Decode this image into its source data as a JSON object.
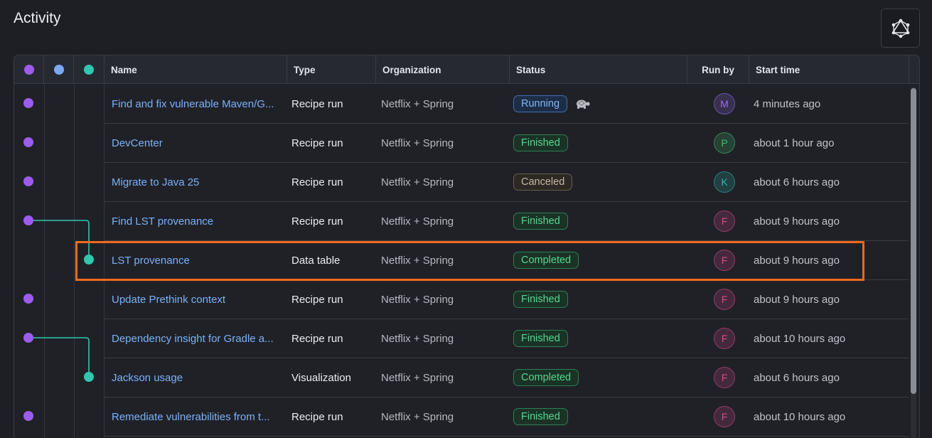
{
  "title": "Activity",
  "graph_button_icon": "graph-network-icon",
  "lanes": [
    {
      "color": "#9d5cf0"
    },
    {
      "color": "#7aa8f5"
    },
    {
      "color": "#2ec7b0"
    }
  ],
  "columns": {
    "name": "Name",
    "type": "Type",
    "organization": "Organization",
    "status": "Status",
    "run_by": "Run by",
    "start_time": "Start time"
  },
  "status_colors": {
    "running": "#82b5f8",
    "finished": "#57d690",
    "completed": "#57d690",
    "canceled": "#c6b9a8"
  },
  "rows": [
    {
      "name": "Find and fix vulnerable Maven/G...",
      "type": "Recipe run",
      "org": "Netflix + Spring",
      "status": "Running",
      "status_kind": "running",
      "slow_icon": "turtle-icon",
      "runby": "M",
      "avatar_color": "#9b6cf0",
      "start": "4 minutes ago",
      "lane": 0
    },
    {
      "name": "DevCenter",
      "type": "Recipe run",
      "org": "Netflix + Spring",
      "status": "Finished",
      "status_kind": "finished",
      "runby": "P",
      "avatar_color": "#3fc16e",
      "start": "about 1 hour ago",
      "lane": 0
    },
    {
      "name": "Migrate to Java 25",
      "type": "Recipe run",
      "org": "Netflix + Spring",
      "status": "Canceled",
      "status_kind": "canceled",
      "runby": "K",
      "avatar_color": "#2bb9b0",
      "start": "about 6 hours ago",
      "lane": 0
    },
    {
      "name": "Find LST provenance",
      "type": "Recipe run",
      "org": "Netflix + Spring",
      "status": "Finished",
      "status_kind": "finished",
      "runby": "F",
      "avatar_color": "#d94a8f",
      "start": "about 9 hours ago",
      "lane": 0
    },
    {
      "name": "LST provenance",
      "type": "Data table",
      "org": "Netflix + Spring",
      "status": "Completed",
      "status_kind": "completed",
      "runby": "F",
      "avatar_color": "#d94a8f",
      "start": "about 9 hours ago",
      "lane": 2
    },
    {
      "name": "Update Prethink context",
      "type": "Recipe run",
      "org": "Netflix + Spring",
      "status": "Finished",
      "status_kind": "finished",
      "runby": "F",
      "avatar_color": "#d94a8f",
      "start": "about 9 hours ago",
      "lane": 0
    },
    {
      "name": "Dependency insight for Gradle a...",
      "type": "Recipe run",
      "org": "Netflix + Spring",
      "status": "Finished",
      "status_kind": "finished",
      "runby": "F",
      "avatar_color": "#d94a8f",
      "start": "about 10 hours ago",
      "lane": 0
    },
    {
      "name": "Jackson usage",
      "type": "Visualization",
      "org": "Netflix + Spring",
      "status": "Completed",
      "status_kind": "completed",
      "runby": "F",
      "avatar_color": "#d94a8f",
      "start": "about 6 hours ago",
      "lane": 2
    },
    {
      "name": "Remediate vulnerabilities from t...",
      "type": "Recipe run",
      "org": "Netflix + Spring",
      "status": "Finished",
      "status_kind": "finished",
      "runby": "F",
      "avatar_color": "#d94a8f",
      "start": "about 10 hours ago",
      "lane": 0
    }
  ],
  "highlighted_row": 4
}
